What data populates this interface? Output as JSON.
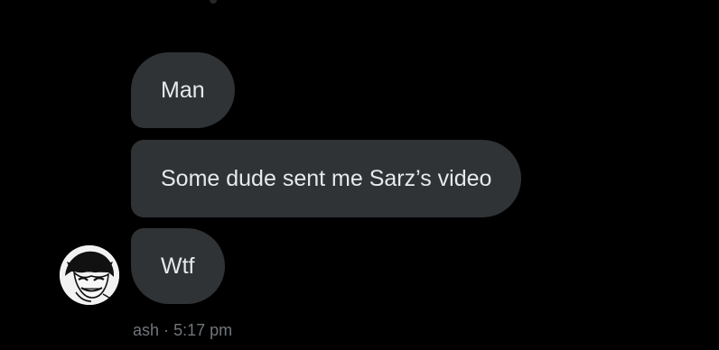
{
  "conversation": {
    "messages": [
      {
        "text": "Man"
      },
      {
        "text": "Some dude sent me Sarz’s video"
      },
      {
        "text": "Wtf"
      }
    ],
    "sender": {
      "name": "ash",
      "time": "5:17 pm",
      "separator": "·"
    }
  },
  "colors": {
    "background": "#000000",
    "bubble": "#2f3336",
    "text": "#e7e9ea",
    "meta": "#71767b"
  },
  "icons": {
    "avatar": "anime-character-avatar-icon"
  }
}
